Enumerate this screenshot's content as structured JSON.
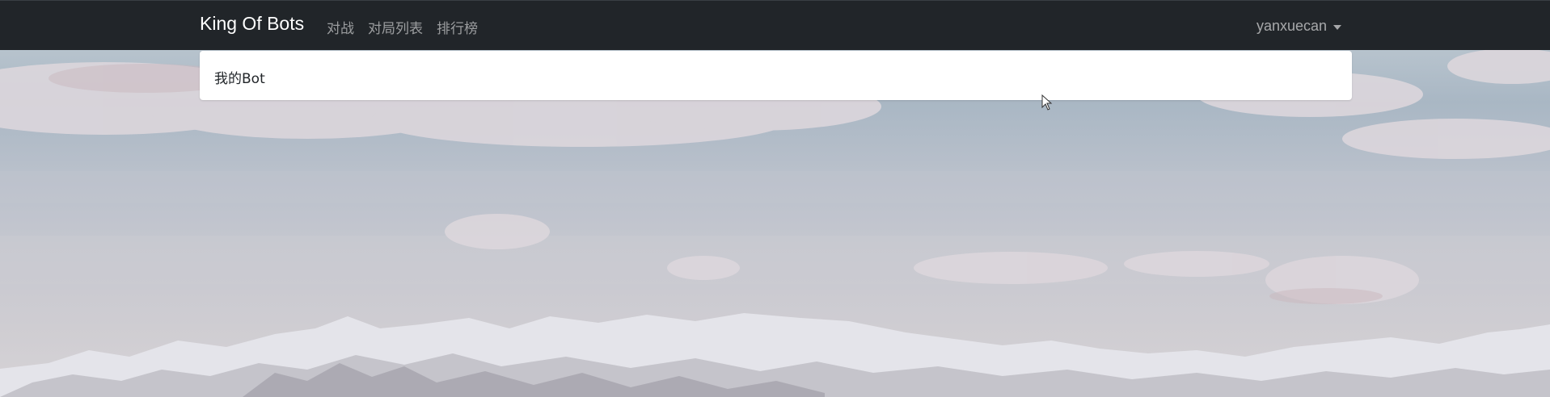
{
  "navbar": {
    "brand": "King Of Bots",
    "links": [
      "对战",
      "对局列表",
      "排行榜"
    ],
    "user_name": "yanxuecan"
  },
  "card": {
    "text": "我的Bot"
  },
  "icons": {
    "dropdown": "caret-down-icon",
    "cursor": "mouse-pointer-icon"
  },
  "colors": {
    "navbar_bg": "#212529",
    "card_bg": "#ffffff"
  }
}
